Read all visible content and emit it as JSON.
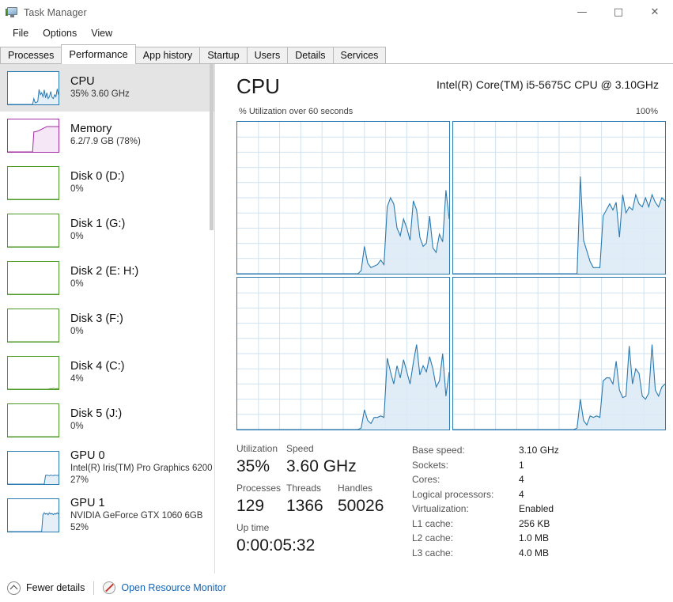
{
  "window": {
    "title": "Task Manager",
    "icon": "task-manager-icon",
    "minimize_glyph": "—",
    "maximize_glyph": "□",
    "close_glyph": "✕"
  },
  "menu": {
    "items": [
      {
        "label": "File"
      },
      {
        "label": "Options"
      },
      {
        "label": "View"
      }
    ]
  },
  "tabs": [
    {
      "label": "Processes",
      "active": false
    },
    {
      "label": "Performance",
      "active": true
    },
    {
      "label": "App history",
      "active": false
    },
    {
      "label": "Startup",
      "active": false
    },
    {
      "label": "Users",
      "active": false
    },
    {
      "label": "Details",
      "active": false
    },
    {
      "label": "Services",
      "active": false
    }
  ],
  "sidebar": {
    "items": [
      {
        "title": "CPU",
        "sub": "35%  3.60 GHz",
        "sub2": "",
        "color": "#2a7ab0",
        "selected": true
      },
      {
        "title": "Memory",
        "sub": "6.2/7.9 GB (78%)",
        "sub2": "",
        "color": "#a32ba3",
        "selected": false
      },
      {
        "title": "Disk 0 (D:)",
        "sub": "0%",
        "sub2": "",
        "color": "#4e9a28",
        "selected": false
      },
      {
        "title": "Disk 1 (G:)",
        "sub": "0%",
        "sub2": "",
        "color": "#4e9a28",
        "selected": false
      },
      {
        "title": "Disk 2 (E: H:)",
        "sub": "0%",
        "sub2": "",
        "color": "#4e9a28",
        "selected": false
      },
      {
        "title": "Disk 3 (F:)",
        "sub": "0%",
        "sub2": "",
        "color": "#4e9a28",
        "selected": false
      },
      {
        "title": "Disk 4 (C:)",
        "sub": "4%",
        "sub2": "",
        "color": "#4e9a28",
        "selected": false
      },
      {
        "title": "Disk 5 (J:)",
        "sub": "0%",
        "sub2": "",
        "color": "#4e9a28",
        "selected": false
      },
      {
        "title": "GPU 0",
        "sub": "Intel(R) Iris(TM) Pro Graphics 6200",
        "sub2": "27%",
        "color": "#2a7ab0",
        "selected": false
      },
      {
        "title": "GPU 1",
        "sub": "NVIDIA GeForce GTX 1060 6GB",
        "sub2": "52%",
        "color": "#2a7ab0",
        "selected": false
      }
    ]
  },
  "main": {
    "heading": "CPU",
    "model": "Intel(R) Core(TM) i5-5675C CPU @ 3.10GHz",
    "graph_caption": "% Utilization over 60 seconds",
    "graph_max": "100%"
  },
  "stats": {
    "left": [
      {
        "label": "Utilization",
        "value": "35%"
      },
      {
        "label": "Speed",
        "value": "3.60 GHz"
      },
      {
        "label": "Processes",
        "value": "129"
      },
      {
        "label": "Threads",
        "value": "1366"
      },
      {
        "label": "Handles",
        "value": "50026"
      },
      {
        "label": "Up time",
        "value": "0:00:05:32"
      }
    ],
    "right": [
      {
        "label": "Base speed:",
        "value": "3.10 GHz"
      },
      {
        "label": "Sockets:",
        "value": "1"
      },
      {
        "label": "Cores:",
        "value": "4"
      },
      {
        "label": "Logical processors:",
        "value": "4"
      },
      {
        "label": "Virtualization:",
        "value": "Enabled"
      },
      {
        "label": "L1 cache:",
        "value": "256 KB"
      },
      {
        "label": "L2 cache:",
        "value": "1.0 MB"
      },
      {
        "label": "L3 cache:",
        "value": "4.0 MB"
      }
    ]
  },
  "footer": {
    "fewer_details": "Fewer details",
    "resource_monitor": "Open Resource Monitor",
    "link_color": "#1464b4"
  },
  "chart_data": [
    {
      "type": "area",
      "title": "Logical processor 0",
      "xlabel": "60 seconds",
      "ylabel": "% Utilization",
      "ylim": [
        0,
        100
      ],
      "grid": true,
      "color": "#2a7ab0",
      "fill": "#dbeaf6",
      "values": [
        0,
        0,
        0,
        0,
        0,
        0,
        0,
        0,
        0,
        0,
        0,
        0,
        0,
        0,
        0,
        0,
        0,
        0,
        0,
        0,
        0,
        0,
        0,
        0,
        0,
        0,
        0,
        0,
        0,
        0,
        0,
        0,
        0,
        0,
        0,
        0,
        0,
        0,
        2,
        18,
        7,
        4,
        5,
        6,
        9,
        6,
        44,
        50,
        46,
        30,
        25,
        36,
        30,
        22,
        48,
        42,
        24,
        18,
        20,
        38,
        17,
        14,
        26,
        21,
        55,
        36
      ]
    },
    {
      "type": "area",
      "title": "Logical processor 1",
      "xlabel": "60 seconds",
      "ylabel": "% Utilization",
      "ylim": [
        0,
        100
      ],
      "grid": true,
      "color": "#2a7ab0",
      "fill": "#dbeaf6",
      "values": [
        0,
        0,
        0,
        0,
        0,
        0,
        0,
        0,
        0,
        0,
        0,
        0,
        0,
        0,
        0,
        0,
        0,
        0,
        0,
        0,
        0,
        0,
        0,
        0,
        0,
        0,
        0,
        0,
        0,
        0,
        0,
        0,
        0,
        0,
        0,
        0,
        0,
        0,
        0,
        64,
        22,
        15,
        8,
        4,
        4,
        4,
        38,
        42,
        46,
        42,
        47,
        24,
        52,
        40,
        44,
        42,
        52,
        46,
        44,
        50,
        44,
        52,
        47,
        44,
        50,
        48
      ]
    },
    {
      "type": "area",
      "title": "Logical processor 2",
      "xlabel": "60 seconds",
      "ylabel": "% Utilization",
      "ylim": [
        0,
        100
      ],
      "grid": true,
      "color": "#2a7ab0",
      "fill": "#dbeaf6",
      "values": [
        0,
        0,
        0,
        0,
        0,
        0,
        0,
        0,
        0,
        0,
        0,
        0,
        0,
        0,
        0,
        0,
        0,
        0,
        0,
        0,
        0,
        0,
        0,
        0,
        0,
        0,
        0,
        0,
        0,
        0,
        0,
        0,
        0,
        0,
        0,
        0,
        0,
        0,
        1,
        13,
        6,
        4,
        8,
        8,
        9,
        8,
        47,
        38,
        30,
        42,
        34,
        46,
        38,
        30,
        44,
        56,
        36,
        42,
        38,
        48,
        40,
        28,
        32,
        50,
        22,
        38
      ]
    },
    {
      "type": "area",
      "title": "Logical processor 3",
      "xlabel": "60 seconds",
      "ylabel": "% Utilization",
      "ylim": [
        0,
        100
      ],
      "grid": true,
      "color": "#2a7ab0",
      "fill": "#dbeaf6",
      "values": [
        0,
        0,
        0,
        0,
        0,
        0,
        0,
        0,
        0,
        0,
        0,
        0,
        0,
        0,
        0,
        0,
        0,
        0,
        0,
        0,
        0,
        0,
        0,
        0,
        0,
        0,
        0,
        0,
        0,
        0,
        0,
        0,
        0,
        0,
        0,
        0,
        0,
        0,
        1,
        20,
        6,
        3,
        9,
        8,
        9,
        8,
        32,
        34,
        34,
        30,
        45,
        26,
        21,
        22,
        55,
        30,
        40,
        37,
        22,
        20,
        24,
        56,
        26,
        22,
        28,
        30
      ]
    }
  ],
  "sidebar_thumbs": [
    {
      "name": "cpu",
      "values": [
        0,
        0,
        0,
        0,
        0,
        0,
        0,
        0,
        0,
        0,
        0,
        0,
        0,
        0,
        0,
        0,
        0,
        0,
        0,
        0,
        18,
        5,
        6,
        9,
        46,
        30,
        36,
        24,
        45,
        20,
        36,
        18,
        24,
        40,
        22,
        18,
        30,
        24,
        48,
        30
      ]
    },
    {
      "name": "memory",
      "values": [
        0,
        0,
        0,
        0,
        0,
        0,
        0,
        0,
        0,
        0,
        0,
        0,
        0,
        0,
        0,
        0,
        0,
        0,
        0,
        0,
        62,
        62,
        63,
        64,
        66,
        68,
        70,
        72,
        74,
        76,
        78,
        78,
        78,
        78,
        78,
        78,
        78,
        78,
        78,
        78
      ]
    },
    {
      "name": "flat",
      "values": [
        0,
        0,
        0,
        0,
        0,
        0,
        0,
        0,
        0,
        0,
        0,
        0,
        0,
        0,
        0,
        0,
        0,
        0,
        0,
        0,
        0,
        0,
        0,
        0,
        0,
        0,
        0,
        0,
        0,
        0,
        0,
        0,
        0,
        0,
        0,
        0,
        0,
        0,
        0,
        0
      ]
    },
    {
      "name": "disk4",
      "values": [
        0,
        0,
        0,
        0,
        0,
        0,
        0,
        0,
        0,
        0,
        0,
        0,
        0,
        0,
        0,
        0,
        0,
        0,
        0,
        0,
        0,
        0,
        0,
        0,
        0,
        0,
        0,
        0,
        0,
        0,
        0,
        0,
        1,
        2,
        1,
        3,
        2,
        1,
        2,
        1
      ]
    },
    {
      "name": "gpu0",
      "values": [
        0,
        0,
        0,
        0,
        0,
        0,
        0,
        0,
        0,
        0,
        0,
        0,
        0,
        0,
        0,
        0,
        0,
        0,
        0,
        0,
        0,
        0,
        0,
        0,
        0,
        0,
        0,
        0,
        0,
        27,
        28,
        27,
        26,
        28,
        27,
        26,
        28,
        27,
        27,
        27
      ]
    },
    {
      "name": "gpu1",
      "values": [
        0,
        0,
        0,
        0,
        0,
        0,
        0,
        0,
        0,
        0,
        0,
        0,
        0,
        0,
        0,
        0,
        0,
        0,
        0,
        0,
        0,
        0,
        0,
        0,
        0,
        0,
        0,
        52,
        58,
        54,
        56,
        52,
        58,
        54,
        56,
        52,
        56,
        54,
        58,
        54
      ]
    }
  ]
}
